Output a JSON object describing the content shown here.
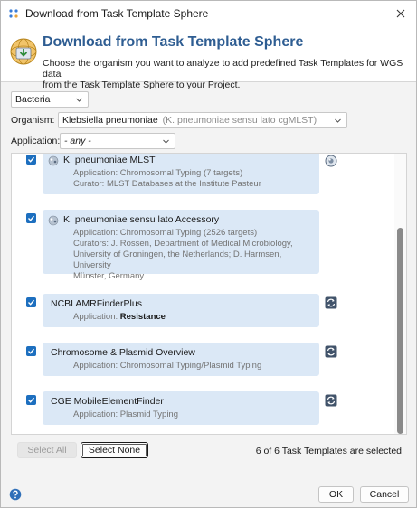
{
  "window": {
    "title": "Download from Task Template Sphere",
    "icons": {
      "app": "app-grid-icon",
      "close": "close-icon"
    }
  },
  "header": {
    "title": "Download from Task Template Sphere",
    "description_line1": "Choose the organism you want to analyze to add predefined Task Templates for WGS data",
    "description_line2": "from the Task Template Sphere to your Project.",
    "icon": "sphere-download-icon"
  },
  "filters": {
    "kingdom": {
      "value": "Bacteria"
    },
    "organism": {
      "label": "Organism:",
      "value": "Klebsiella pneumoniae",
      "hint": "(K. pneumoniae sensu lato cgMLST)"
    },
    "application": {
      "label": "Application:",
      "value": "- any -"
    }
  },
  "items": [
    {
      "name": "K. pneumoniae MLST",
      "checked": true,
      "details": [
        "Application: Chromosomal Typing (7 targets)",
        "Curator: MLST Databases at the Institute Pasteur"
      ],
      "status_icon": "sphere-status-icon"
    },
    {
      "name": "K. pneumoniae sensu lato Accessory",
      "checked": true,
      "details": [
        "Application: Chromosomal Typing (2526 targets)",
        "Curators: J. Rossen, Department of Medical Microbiology,",
        "University of Groningen, the Netherlands; D. Harmsen, University",
        "Münster, Germany"
      ]
    },
    {
      "name": "NCBI AMRFinderPlus",
      "checked": true,
      "details_prefix": "Application: ",
      "details_bold": "Resistance",
      "status_icon": "sync-icon"
    },
    {
      "name": "Chromosome & Plasmid Overview",
      "checked": true,
      "details": [
        "Application: Chromosomal Typing/Plasmid Typing"
      ],
      "status_icon": "sync-icon"
    },
    {
      "name": "CGE MobileElementFinder",
      "checked": true,
      "details": [
        "Application: Plasmid Typing"
      ],
      "status_icon": "sync-icon"
    }
  ],
  "actions": {
    "select_all": "Select All",
    "select_none": "Select None",
    "status": "6 of 6 Task Templates are selected",
    "ok": "OK",
    "cancel": "Cancel"
  },
  "colors": {
    "accent": "#2e5d92",
    "checkbox": "#1d6fbf",
    "card": "#dbe8f6"
  }
}
